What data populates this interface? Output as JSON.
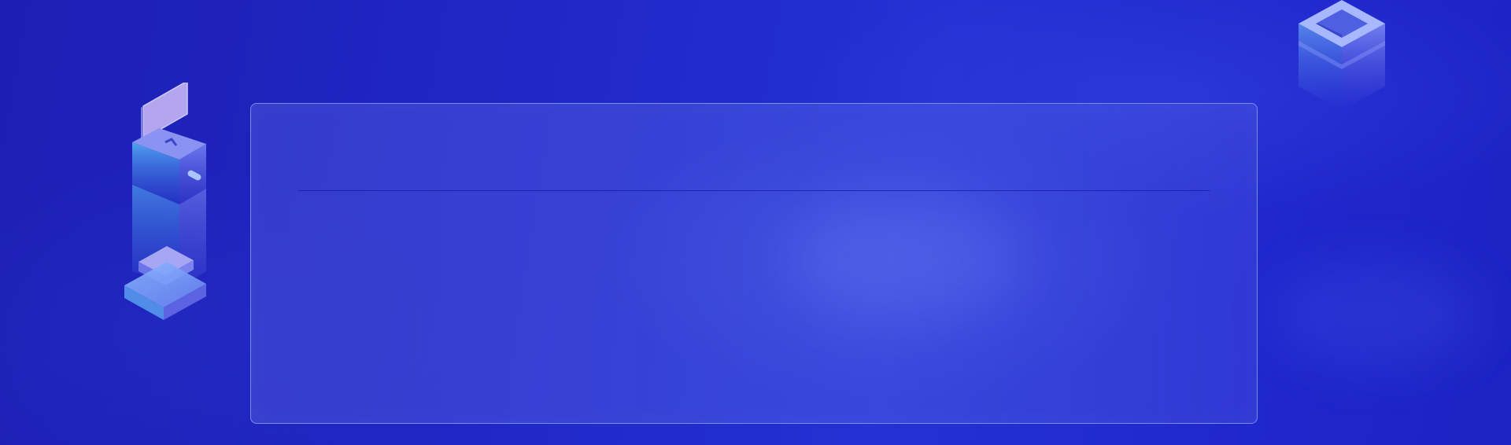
{
  "panel": {
    "divider": true
  },
  "colors": {
    "background": "#1d24c9",
    "panel_border": "#8caaff",
    "divider": "#141eaa"
  },
  "decorations": {
    "left_art": "isometric-kiosk-icon",
    "right_art": "isometric-box-icon"
  }
}
